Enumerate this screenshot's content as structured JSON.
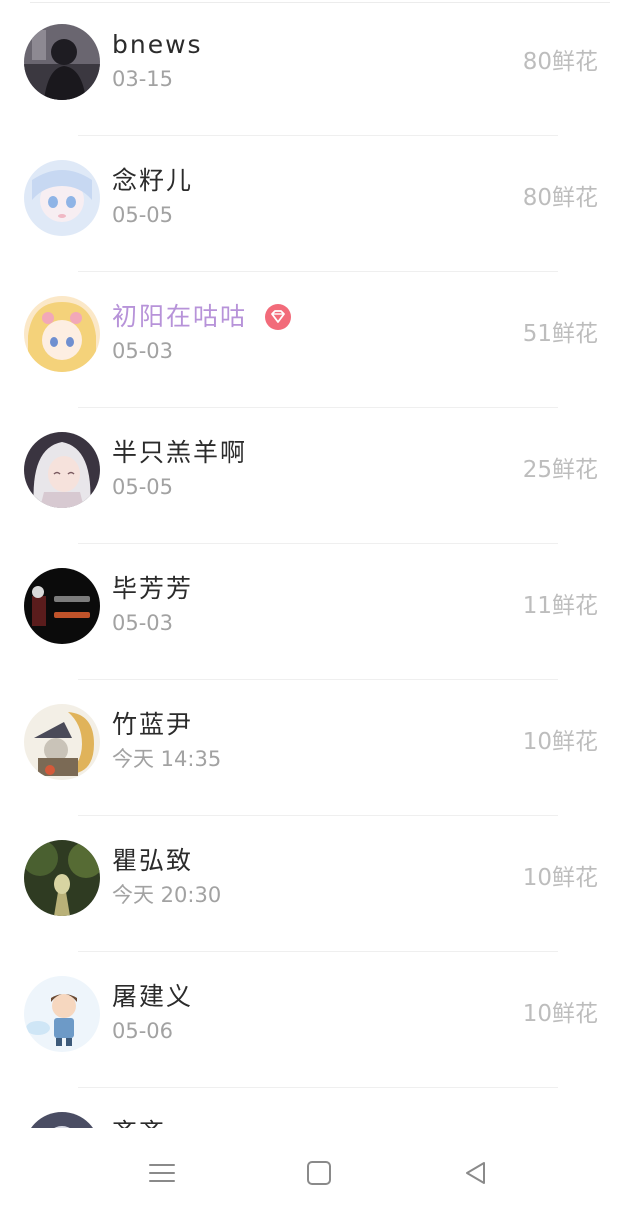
{
  "leaderboard": {
    "unit_suffix": "鲜花",
    "entries": [
      {
        "name": "bnews",
        "time": "03-15",
        "flowers": "80鲜花",
        "avatar": "dark-figure-avatar",
        "vip": false
      },
      {
        "name": "念籽儿",
        "time": "05-05",
        "flowers": "80鲜花",
        "avatar": "anime-girl-blue-avatar",
        "vip": false
      },
      {
        "name": "初阳在咕咕",
        "time": "05-03",
        "flowers": "51鲜花",
        "avatar": "anime-girl-blonde-avatar",
        "vip": true
      },
      {
        "name": "半只羔羊啊",
        "time": "05-05",
        "flowers": "25鲜花",
        "avatar": "anime-girl-white-hair-avatar",
        "vip": false
      },
      {
        "name": "毕芳芳",
        "time": "05-03",
        "flowers": "11鲜花",
        "avatar": "dark-text-avatar",
        "vip": false
      },
      {
        "name": "竹蓝尹",
        "time": "今天 14:35",
        "flowers": "10鲜花",
        "avatar": "witch-character-avatar",
        "vip": false
      },
      {
        "name": "瞿弘致",
        "time": "今天 20:30",
        "flowers": "10鲜花",
        "avatar": "forest-path-avatar",
        "vip": false
      },
      {
        "name": "屠建义",
        "time": "05-06",
        "flowers": "10鲜花",
        "avatar": "cartoon-boy-avatar",
        "vip": false
      },
      {
        "name": "齐齐",
        "time": "",
        "flowers": "",
        "avatar": "partial-avatar",
        "vip": false
      }
    ]
  },
  "colors": {
    "vip_name": "#b793d9",
    "vip_badge": "#f26b7a",
    "name": "#2b2b2b",
    "secondary": "#a2a2a2",
    "flowers": "#bdbdbd"
  },
  "navigation": {
    "menu_icon": "menu-lines-icon",
    "home_icon": "square-home-icon",
    "back_icon": "triangle-back-icon"
  }
}
